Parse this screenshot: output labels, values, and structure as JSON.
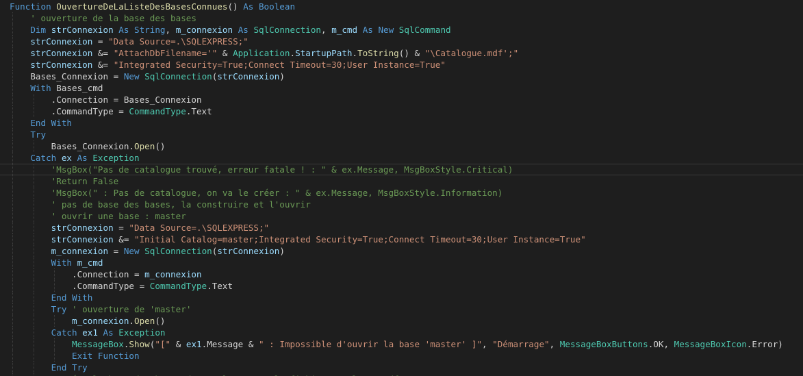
{
  "editor": {
    "language": "Visual Basic .NET",
    "theme_colors": {
      "background": "#1e1e1e",
      "keyword": "#569cd6",
      "type": "#4ec9b0",
      "function": "#dcdcaa",
      "string": "#ce9178",
      "comment": "#6a9955",
      "identifier": "#9cdcfe",
      "plain": "#d4d4d4"
    },
    "highlighted_line_index": 14,
    "lines": [
      {
        "indent": 0,
        "tokens": [
          [
            "kw",
            "Function "
          ],
          [
            "fn",
            "OuvertureDeLaListeDesBasesConnues"
          ],
          [
            "pl",
            "() "
          ],
          [
            "kw",
            "As "
          ],
          [
            "kw",
            "Boolean"
          ]
        ]
      },
      {
        "indent": 1,
        "tokens": [
          [
            "cm",
            "' ouverture de la base des bases"
          ]
        ]
      },
      {
        "indent": 1,
        "tokens": [
          [
            "kw",
            "Dim "
          ],
          [
            "id",
            "strConnexion "
          ],
          [
            "kw",
            "As "
          ],
          [
            "kw",
            "String"
          ],
          [
            "pl",
            ", "
          ],
          [
            "id",
            "m_connexion "
          ],
          [
            "kw",
            "As "
          ],
          [
            "ty",
            "SqlConnection"
          ],
          [
            "pl",
            ", "
          ],
          [
            "id",
            "m_cmd "
          ],
          [
            "kw",
            "As "
          ],
          [
            "kw",
            "New "
          ],
          [
            "ty",
            "SqlCommand"
          ]
        ]
      },
      {
        "indent": 1,
        "tokens": [
          [
            "id",
            "strConnexion"
          ],
          [
            "pl",
            " = "
          ],
          [
            "st",
            "\"Data Source=.\\SQLEXPRESS;\""
          ]
        ]
      },
      {
        "indent": 1,
        "tokens": [
          [
            "id",
            "strConnexion"
          ],
          [
            "pl",
            " &= "
          ],
          [
            "st",
            "\"AttachDbFilename='\""
          ],
          [
            "pl",
            " & "
          ],
          [
            "ty",
            "Application"
          ],
          [
            "pl",
            "."
          ],
          [
            "id",
            "StartupPath"
          ],
          [
            "pl",
            "."
          ],
          [
            "fn",
            "ToString"
          ],
          [
            "pl",
            "() & "
          ],
          [
            "st",
            "\"\\Catalogue.mdf';\""
          ]
        ]
      },
      {
        "indent": 1,
        "tokens": [
          [
            "id",
            "strConnexion"
          ],
          [
            "pl",
            " &= "
          ],
          [
            "st",
            "\"Integrated Security=True;Connect Timeout=30;User Instance=True\""
          ]
        ]
      },
      {
        "indent": 1,
        "tokens": [
          [
            "pl",
            "Bases_Connexion = "
          ],
          [
            "kw",
            "New "
          ],
          [
            "ty",
            "SqlConnection"
          ],
          [
            "pl",
            "("
          ],
          [
            "id",
            "strConnexion"
          ],
          [
            "pl",
            ")"
          ]
        ]
      },
      {
        "indent": 1,
        "tokens": [
          [
            "kw",
            "With "
          ],
          [
            "pl",
            "Bases_cmd"
          ]
        ]
      },
      {
        "indent": 2,
        "tokens": [
          [
            "pl",
            ".Connection = Bases_Connexion"
          ]
        ]
      },
      {
        "indent": 2,
        "tokens": [
          [
            "pl",
            ".CommandType = "
          ],
          [
            "ty",
            "CommandType"
          ],
          [
            "pl",
            ".Text"
          ]
        ]
      },
      {
        "indent": 1,
        "tokens": [
          [
            "kw",
            "End With"
          ]
        ]
      },
      {
        "indent": 1,
        "tokens": [
          [
            "kw",
            "Try"
          ]
        ]
      },
      {
        "indent": 2,
        "tokens": [
          [
            "pl",
            "Bases_Connexion."
          ],
          [
            "fn",
            "Open"
          ],
          [
            "pl",
            "()"
          ]
        ]
      },
      {
        "indent": 1,
        "tokens": [
          [
            "kw",
            "Catch "
          ],
          [
            "id",
            "ex "
          ],
          [
            "kw",
            "As "
          ],
          [
            "ty",
            "Exception"
          ]
        ]
      },
      {
        "indent": 2,
        "tokens": [
          [
            "cm",
            "'MsgBox(\"Pas de catalogue trouvé, erreur fatale ! : \" & ex.Message, MsgBoxStyle.Critical)"
          ]
        ]
      },
      {
        "indent": 2,
        "tokens": [
          [
            "cm",
            "'Return False"
          ]
        ]
      },
      {
        "indent": 2,
        "tokens": [
          [
            "cm",
            "'MsgBox(\" : Pas de catalogue, on va le créer : \" & ex.Message, MsgBoxStyle.Information)"
          ]
        ]
      },
      {
        "indent": 2,
        "tokens": [
          [
            "cm",
            "' pas de base des bases, la construire et l'ouvrir"
          ]
        ]
      },
      {
        "indent": 2,
        "tokens": [
          [
            "cm",
            "' ouvrir une base : master"
          ]
        ]
      },
      {
        "indent": 2,
        "tokens": [
          [
            "id",
            "strConnexion"
          ],
          [
            "pl",
            " = "
          ],
          [
            "st",
            "\"Data Source=.\\SQLEXPRESS;\""
          ]
        ]
      },
      {
        "indent": 2,
        "tokens": [
          [
            "id",
            "strConnexion"
          ],
          [
            "pl",
            " &= "
          ],
          [
            "st",
            "\"Initial Catalog=master;Integrated Security=True;Connect Timeout=30;User Instance=True\""
          ]
        ]
      },
      {
        "indent": 2,
        "tokens": [
          [
            "id",
            "m_connexion"
          ],
          [
            "pl",
            " = "
          ],
          [
            "kw",
            "New "
          ],
          [
            "ty",
            "SqlConnection"
          ],
          [
            "pl",
            "("
          ],
          [
            "id",
            "strConnexion"
          ],
          [
            "pl",
            ")"
          ]
        ]
      },
      {
        "indent": 2,
        "tokens": [
          [
            "kw",
            "With "
          ],
          [
            "id",
            "m_cmd"
          ]
        ]
      },
      {
        "indent": 3,
        "tokens": [
          [
            "pl",
            ".Connection = "
          ],
          [
            "id",
            "m_connexion"
          ]
        ]
      },
      {
        "indent": 3,
        "tokens": [
          [
            "pl",
            ".CommandType = "
          ],
          [
            "ty",
            "CommandType"
          ],
          [
            "pl",
            ".Text"
          ]
        ]
      },
      {
        "indent": 2,
        "tokens": [
          [
            "kw",
            "End With"
          ]
        ]
      },
      {
        "indent": 2,
        "tokens": [
          [
            "kw",
            "Try "
          ],
          [
            "cm",
            "' ouverture de 'master'"
          ]
        ]
      },
      {
        "indent": 3,
        "tokens": [
          [
            "id",
            "m_connexion"
          ],
          [
            "pl",
            "."
          ],
          [
            "fn",
            "Open"
          ],
          [
            "pl",
            "()"
          ]
        ]
      },
      {
        "indent": 2,
        "tokens": [
          [
            "kw",
            "Catch "
          ],
          [
            "id",
            "ex1 "
          ],
          [
            "kw",
            "As "
          ],
          [
            "ty",
            "Exception"
          ]
        ]
      },
      {
        "indent": 3,
        "tokens": [
          [
            "ty",
            "MessageBox"
          ],
          [
            "pl",
            "."
          ],
          [
            "fn",
            "Show"
          ],
          [
            "pl",
            "("
          ],
          [
            "st",
            "\"[\""
          ],
          [
            "pl",
            " & "
          ],
          [
            "id",
            "ex1"
          ],
          [
            "pl",
            ".Message & "
          ],
          [
            "st",
            "\" : Impossible d'ouvrir la base 'master' ]\""
          ],
          [
            "pl",
            ", "
          ],
          [
            "st",
            "\"Démarrage\""
          ],
          [
            "pl",
            ", "
          ],
          [
            "ty",
            "MessageBoxButtons"
          ],
          [
            "pl",
            ".OK, "
          ],
          [
            "ty",
            "MessageBoxIcon"
          ],
          [
            "pl",
            ".Error)"
          ]
        ]
      },
      {
        "indent": 3,
        "tokens": [
          [
            "kw",
            "Exit Function"
          ]
        ]
      },
      {
        "indent": 2,
        "tokens": [
          [
            "kw",
            "End Try"
          ]
        ]
      },
      {
        "indent": 2,
        "tokens": [
          [
            "cm",
            "' créer la base des bases du catalogue sur le fichier catalogue.mdf"
          ]
        ]
      }
    ]
  }
}
